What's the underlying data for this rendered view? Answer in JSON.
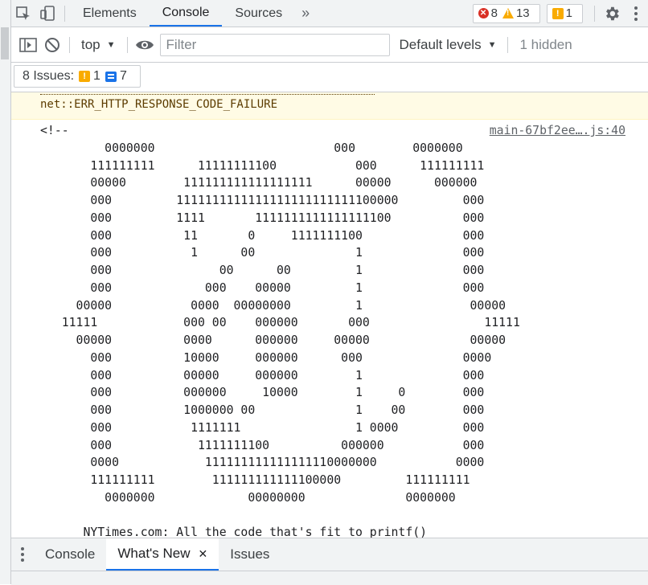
{
  "toolbar": {
    "tabs": [
      "Elements",
      "Console",
      "Sources"
    ],
    "active_tab": "Console",
    "error_count": "8",
    "warning_count": "13",
    "issue_count": "1"
  },
  "console_toolbar": {
    "context": "top",
    "filter_placeholder": "Filter",
    "levels": "Default levels",
    "hidden": "1 hidden"
  },
  "issues": {
    "label": "8 Issues:",
    "warnings": "1",
    "info": "7"
  },
  "messages": {
    "warning_text": "net::ERR_HTTP_RESPONSE_CODE_FAILURE",
    "source_link": "main-67bf2ee….js:40",
    "art": "<!--\n         0000000                         000        0000000\n       111111111      11111111100           000      111111111\n       00000        111111111111111111      00000      000000\n       000         1111111111111111111111111100000         000\n       000         1111       1111111111111111100          000\n       000          11       0     1111111100              000\n       000           1      00              1              000\n       000               00      00         1              000\n       000             000    00000         1              000\n     00000           0000  00000000         1               00000\n   11111            000 00    000000       000                11111\n     00000          0000      000000     00000              00000\n       000          10000     000000      000              0000\n       000          00000     000000        1              000\n       000          000000     10000        1     0        000\n       000          1000000 00              1    00        000\n       000           1111111                1 0000         000\n       000            1111111100          000000           000\n       0000            111111111111111110000000           0000\n       111111111        111111111111100000         111111111\n         0000000             00000000              0000000\n\n      NYTimes.com: All the code that's fit to printf()"
  },
  "drawer": {
    "tabs": [
      "Console",
      "What's New",
      "Issues"
    ],
    "active_tab": "What's New"
  },
  "colors": {
    "accent": "#1a73e8",
    "error": "#d93025",
    "warning": "#f9ab00",
    "warning_bg": "#fffbe5",
    "warning_text": "#5c3c00"
  }
}
